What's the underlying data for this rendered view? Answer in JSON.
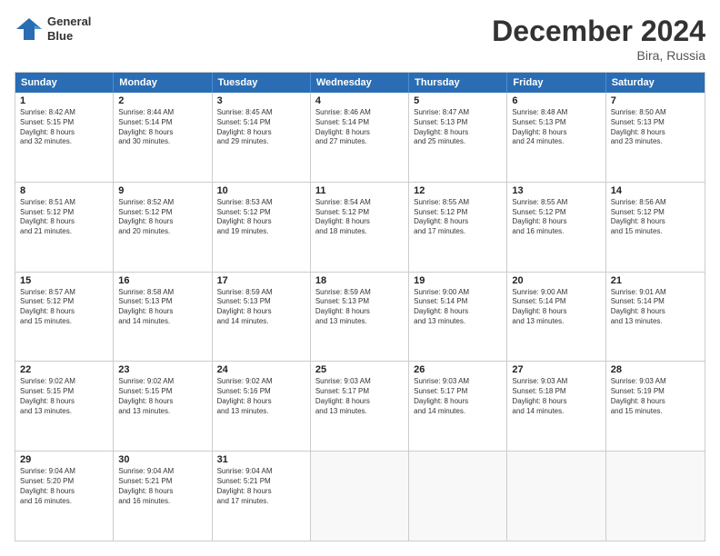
{
  "header": {
    "logo_line1": "General",
    "logo_line2": "Blue",
    "month": "December 2024",
    "location": "Bira, Russia"
  },
  "weekdays": [
    "Sunday",
    "Monday",
    "Tuesday",
    "Wednesday",
    "Thursday",
    "Friday",
    "Saturday"
  ],
  "rows": [
    [
      {
        "day": "1",
        "lines": [
          "Sunrise: 8:42 AM",
          "Sunset: 5:15 PM",
          "Daylight: 8 hours",
          "and 32 minutes."
        ]
      },
      {
        "day": "2",
        "lines": [
          "Sunrise: 8:44 AM",
          "Sunset: 5:14 PM",
          "Daylight: 8 hours",
          "and 30 minutes."
        ]
      },
      {
        "day": "3",
        "lines": [
          "Sunrise: 8:45 AM",
          "Sunset: 5:14 PM",
          "Daylight: 8 hours",
          "and 29 minutes."
        ]
      },
      {
        "day": "4",
        "lines": [
          "Sunrise: 8:46 AM",
          "Sunset: 5:14 PM",
          "Daylight: 8 hours",
          "and 27 minutes."
        ]
      },
      {
        "day": "5",
        "lines": [
          "Sunrise: 8:47 AM",
          "Sunset: 5:13 PM",
          "Daylight: 8 hours",
          "and 25 minutes."
        ]
      },
      {
        "day": "6",
        "lines": [
          "Sunrise: 8:48 AM",
          "Sunset: 5:13 PM",
          "Daylight: 8 hours",
          "and 24 minutes."
        ]
      },
      {
        "day": "7",
        "lines": [
          "Sunrise: 8:50 AM",
          "Sunset: 5:13 PM",
          "Daylight: 8 hours",
          "and 23 minutes."
        ]
      }
    ],
    [
      {
        "day": "8",
        "lines": [
          "Sunrise: 8:51 AM",
          "Sunset: 5:12 PM",
          "Daylight: 8 hours",
          "and 21 minutes."
        ]
      },
      {
        "day": "9",
        "lines": [
          "Sunrise: 8:52 AM",
          "Sunset: 5:12 PM",
          "Daylight: 8 hours",
          "and 20 minutes."
        ]
      },
      {
        "day": "10",
        "lines": [
          "Sunrise: 8:53 AM",
          "Sunset: 5:12 PM",
          "Daylight: 8 hours",
          "and 19 minutes."
        ]
      },
      {
        "day": "11",
        "lines": [
          "Sunrise: 8:54 AM",
          "Sunset: 5:12 PM",
          "Daylight: 8 hours",
          "and 18 minutes."
        ]
      },
      {
        "day": "12",
        "lines": [
          "Sunrise: 8:55 AM",
          "Sunset: 5:12 PM",
          "Daylight: 8 hours",
          "and 17 minutes."
        ]
      },
      {
        "day": "13",
        "lines": [
          "Sunrise: 8:55 AM",
          "Sunset: 5:12 PM",
          "Daylight: 8 hours",
          "and 16 minutes."
        ]
      },
      {
        "day": "14",
        "lines": [
          "Sunrise: 8:56 AM",
          "Sunset: 5:12 PM",
          "Daylight: 8 hours",
          "and 15 minutes."
        ]
      }
    ],
    [
      {
        "day": "15",
        "lines": [
          "Sunrise: 8:57 AM",
          "Sunset: 5:12 PM",
          "Daylight: 8 hours",
          "and 15 minutes."
        ]
      },
      {
        "day": "16",
        "lines": [
          "Sunrise: 8:58 AM",
          "Sunset: 5:13 PM",
          "Daylight: 8 hours",
          "and 14 minutes."
        ]
      },
      {
        "day": "17",
        "lines": [
          "Sunrise: 8:59 AM",
          "Sunset: 5:13 PM",
          "Daylight: 8 hours",
          "and 14 minutes."
        ]
      },
      {
        "day": "18",
        "lines": [
          "Sunrise: 8:59 AM",
          "Sunset: 5:13 PM",
          "Daylight: 8 hours",
          "and 13 minutes."
        ]
      },
      {
        "day": "19",
        "lines": [
          "Sunrise: 9:00 AM",
          "Sunset: 5:14 PM",
          "Daylight: 8 hours",
          "and 13 minutes."
        ]
      },
      {
        "day": "20",
        "lines": [
          "Sunrise: 9:00 AM",
          "Sunset: 5:14 PM",
          "Daylight: 8 hours",
          "and 13 minutes."
        ]
      },
      {
        "day": "21",
        "lines": [
          "Sunrise: 9:01 AM",
          "Sunset: 5:14 PM",
          "Daylight: 8 hours",
          "and 13 minutes."
        ]
      }
    ],
    [
      {
        "day": "22",
        "lines": [
          "Sunrise: 9:02 AM",
          "Sunset: 5:15 PM",
          "Daylight: 8 hours",
          "and 13 minutes."
        ]
      },
      {
        "day": "23",
        "lines": [
          "Sunrise: 9:02 AM",
          "Sunset: 5:15 PM",
          "Daylight: 8 hours",
          "and 13 minutes."
        ]
      },
      {
        "day": "24",
        "lines": [
          "Sunrise: 9:02 AM",
          "Sunset: 5:16 PM",
          "Daylight: 8 hours",
          "and 13 minutes."
        ]
      },
      {
        "day": "25",
        "lines": [
          "Sunrise: 9:03 AM",
          "Sunset: 5:17 PM",
          "Daylight: 8 hours",
          "and 13 minutes."
        ]
      },
      {
        "day": "26",
        "lines": [
          "Sunrise: 9:03 AM",
          "Sunset: 5:17 PM",
          "Daylight: 8 hours",
          "and 14 minutes."
        ]
      },
      {
        "day": "27",
        "lines": [
          "Sunrise: 9:03 AM",
          "Sunset: 5:18 PM",
          "Daylight: 8 hours",
          "and 14 minutes."
        ]
      },
      {
        "day": "28",
        "lines": [
          "Sunrise: 9:03 AM",
          "Sunset: 5:19 PM",
          "Daylight: 8 hours",
          "and 15 minutes."
        ]
      }
    ],
    [
      {
        "day": "29",
        "lines": [
          "Sunrise: 9:04 AM",
          "Sunset: 5:20 PM",
          "Daylight: 8 hours",
          "and 16 minutes."
        ]
      },
      {
        "day": "30",
        "lines": [
          "Sunrise: 9:04 AM",
          "Sunset: 5:21 PM",
          "Daylight: 8 hours",
          "and 16 minutes."
        ]
      },
      {
        "day": "31",
        "lines": [
          "Sunrise: 9:04 AM",
          "Sunset: 5:21 PM",
          "Daylight: 8 hours",
          "and 17 minutes."
        ]
      },
      {
        "day": "",
        "lines": []
      },
      {
        "day": "",
        "lines": []
      },
      {
        "day": "",
        "lines": []
      },
      {
        "day": "",
        "lines": []
      }
    ]
  ]
}
